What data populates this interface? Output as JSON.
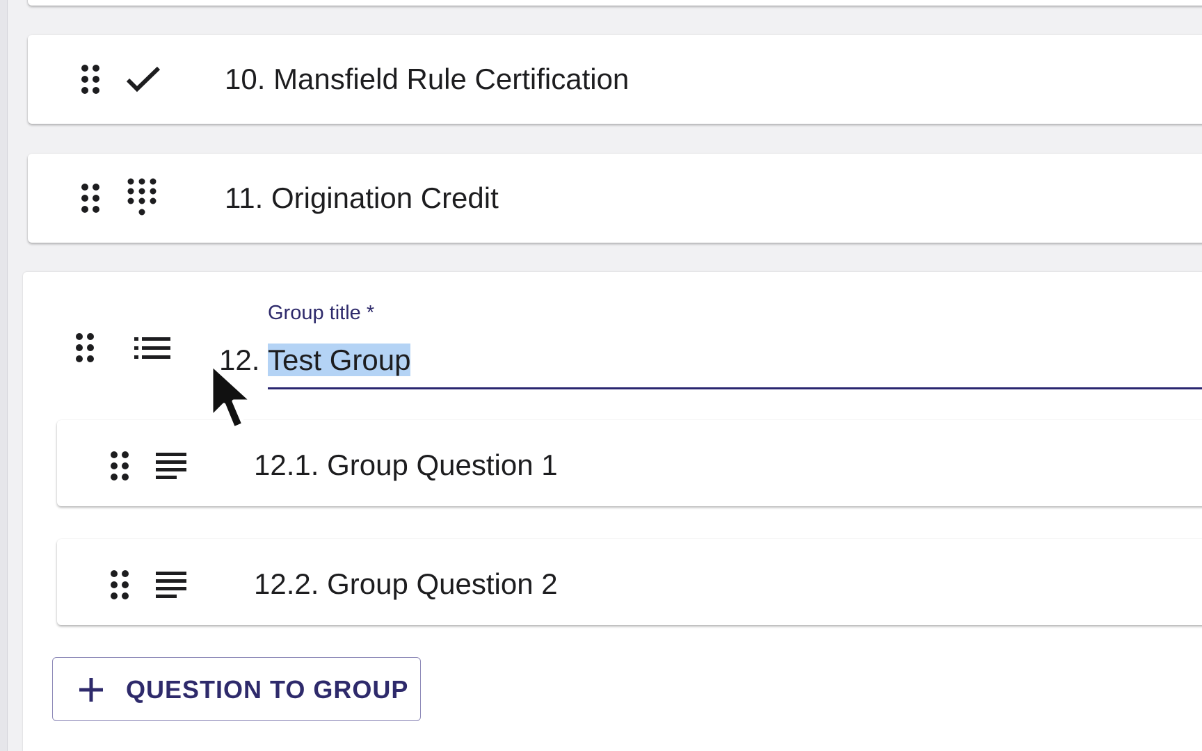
{
  "questions": [
    {
      "number": "10.",
      "title": "Mansfield Rule Certification",
      "type_icon": "check-icon"
    },
    {
      "number": "11.",
      "title": "Origination Credit",
      "type_icon": "dialpad-icon"
    }
  ],
  "group": {
    "number": "12.",
    "field_label": "Group title *",
    "title_value": "Test Group",
    "type_icon": "list-icon",
    "sub_questions": [
      {
        "label": "12.1. Group Question 1",
        "type_icon": "text-lines-icon"
      },
      {
        "label": "12.2. Group Question 2",
        "type_icon": "text-lines-icon"
      }
    ],
    "add_button_label": "QUESTION TO GROUP",
    "add_button_icon": "plus-icon"
  },
  "colors": {
    "accent": "#2e2a6b",
    "underline": "#2a2670",
    "selection": "#b4d3f5",
    "background": "#f1f1f3",
    "card": "#ffffff"
  }
}
